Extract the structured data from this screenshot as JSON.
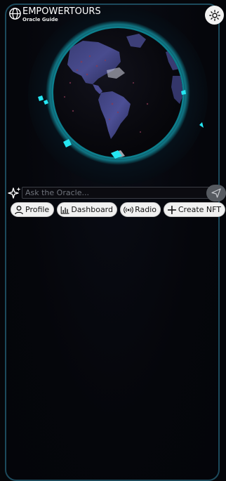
{
  "header": {
    "brand_title": "EMPOWERTOURS",
    "brand_subtitle": "Oracle Guide",
    "brand_icon": "globe-icon",
    "theme_toggle_icon": "sun-icon"
  },
  "chat": {
    "placeholder": "Ask the Oracle...",
    "input_value": "",
    "sparkle_icon": "sparkle-icon",
    "send_icon": "send-icon"
  },
  "actions": [
    {
      "label": "Profile",
      "icon": "user-icon"
    },
    {
      "label": "Dashboard",
      "icon": "bar-chart-icon"
    },
    {
      "label": "Radio",
      "icon": "broadcast-icon"
    },
    {
      "label": "Create NFT",
      "icon": "plus-icon"
    }
  ],
  "colors": {
    "background": "#05060a",
    "frame_border": "#1c4a5c",
    "globe_glow": "#19d6e6",
    "pill_bg": "#f1f1f1",
    "send_bg": "#565a60"
  }
}
